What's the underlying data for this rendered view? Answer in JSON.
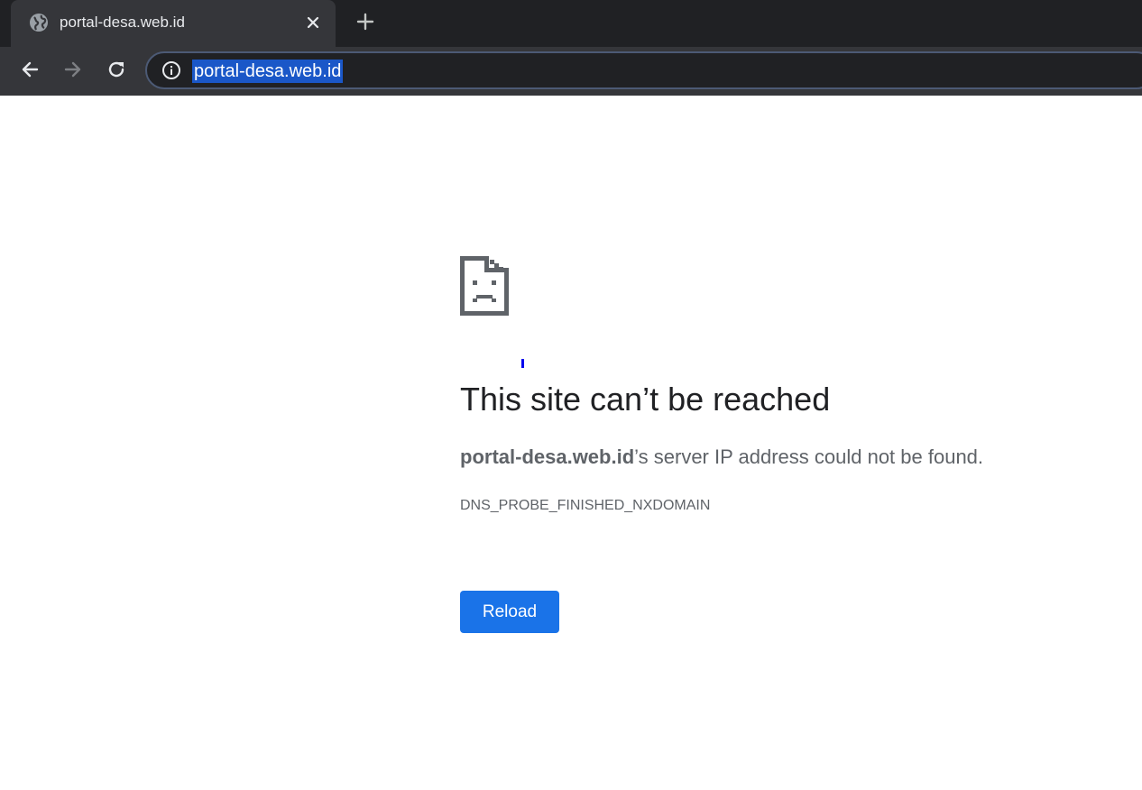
{
  "tab": {
    "title": "portal-desa.web.id",
    "favicon": "globe-icon"
  },
  "toolbar": {
    "back_icon": "back-arrow-icon",
    "forward_icon": "forward-arrow-icon",
    "reload_icon": "reload-icon",
    "site_info_icon": "info-icon",
    "url": "portal-desa.web.id"
  },
  "error": {
    "icon": "sad-document-icon",
    "heading": "This site can’t be reached",
    "host": "portal-desa.web.id",
    "message_suffix": "’s server IP address could not be found.",
    "code": "DNS_PROBE_FINISHED_NXDOMAIN",
    "reload_label": "Reload"
  },
  "colors": {
    "tab_strip_bg": "#202124",
    "toolbar_bg": "#35363a",
    "url_selection": "#1a57c8",
    "button_blue": "#1a73e8",
    "heading_text": "#202124",
    "body_text": "#5f6368"
  }
}
